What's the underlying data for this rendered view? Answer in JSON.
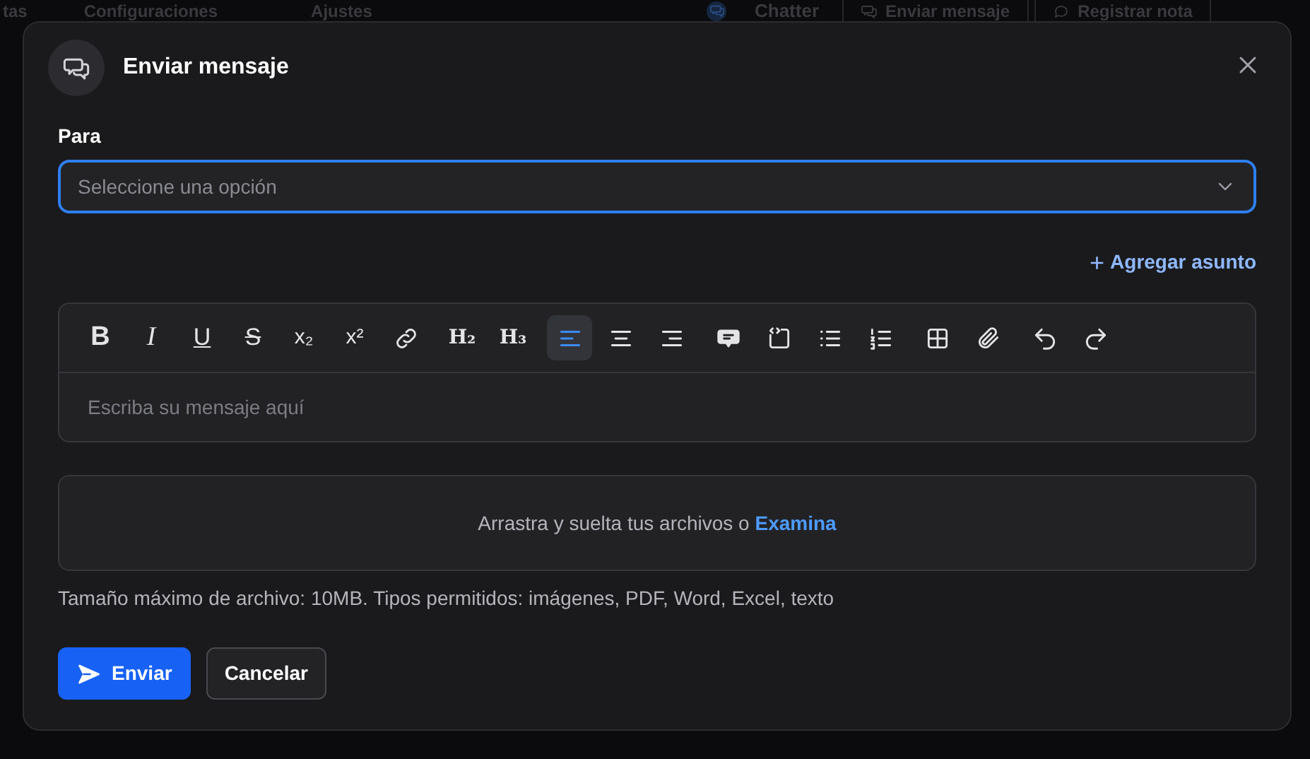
{
  "background": {
    "tabs": [
      "tas",
      "Configuraciones",
      "Ajustes"
    ],
    "chatter": {
      "title": "Chatter",
      "buttons": [
        {
          "kind": "send",
          "label": "Enviar mensaje"
        },
        {
          "kind": "note",
          "label": "Registrar nota"
        }
      ]
    }
  },
  "dialog": {
    "title": "Enviar mensaje",
    "recipient": {
      "label": "Para",
      "placeholder": "Seleccione una opción"
    },
    "add_subject": {
      "icon": "+",
      "label": "Agregar asunto"
    },
    "toolbar": [
      {
        "kind": "bold",
        "label": "B",
        "selected": false
      },
      {
        "kind": "italic",
        "label": "I",
        "selected": false
      },
      {
        "kind": "underline",
        "label": "U",
        "selected": false
      },
      {
        "kind": "strike",
        "label": "S",
        "selected": false
      },
      {
        "kind": "subscript",
        "label": "x₂",
        "selected": false
      },
      {
        "kind": "superscript",
        "label": "x²",
        "selected": false
      },
      {
        "kind": "link",
        "selected": false
      },
      {
        "kind": "heading",
        "label": "H₂",
        "selected": false
      },
      {
        "kind": "heading",
        "label": "H₃",
        "selected": false
      },
      {
        "kind": "align-left",
        "selected": true
      },
      {
        "kind": "align-center",
        "selected": false
      },
      {
        "kind": "align-right",
        "selected": false
      },
      {
        "kind": "comment",
        "selected": false
      },
      {
        "kind": "code",
        "selected": false
      },
      {
        "kind": "bullet-list",
        "selected": false
      },
      {
        "kind": "ordered-list",
        "selected": false
      },
      {
        "kind": "table",
        "selected": false
      },
      {
        "kind": "attach",
        "selected": false
      },
      {
        "kind": "undo",
        "selected": false
      },
      {
        "kind": "redo",
        "selected": false
      }
    ],
    "message": {
      "placeholder": "Escriba su mensaje aquí"
    },
    "dropzone": {
      "text": "Arrastra y suelta tus archivos o",
      "link": "Examina"
    },
    "hint": "Tamaño máximo de archivo: 10MB. Tipos permitidos: imágenes, PDF, Word, Excel, texto",
    "buttons": [
      {
        "kind": "primary",
        "label": "Enviar"
      },
      {
        "kind": "secondary",
        "label": "Cancelar"
      }
    ]
  }
}
